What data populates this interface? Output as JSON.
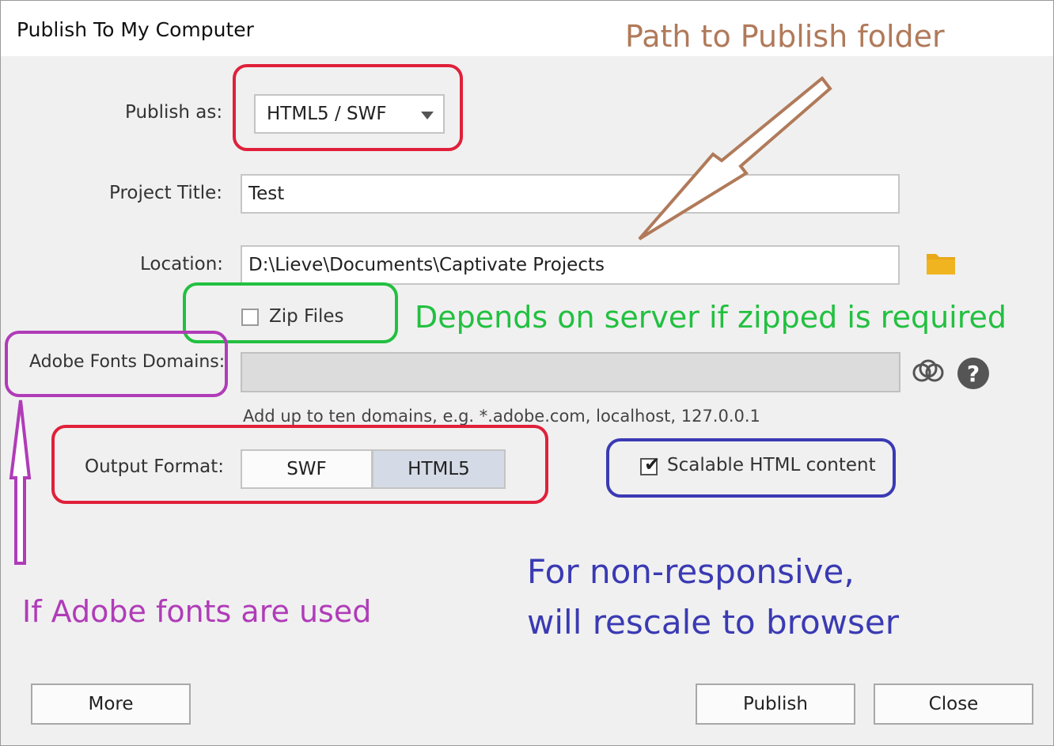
{
  "window": {
    "title": "Publish To My Computer"
  },
  "form": {
    "publish_as": {
      "label": "Publish as:",
      "value": "HTML5 / SWF"
    },
    "project_title": {
      "label": "Project Title:",
      "value": "Test"
    },
    "location": {
      "label": "Location:",
      "value": "D:\\Lieve\\Documents\\Captivate Projects"
    },
    "zip_files": {
      "label": "Zip Files",
      "checked": false
    },
    "adobe_fonts": {
      "label": "Adobe Fonts Domains:",
      "value": "",
      "hint": "Add up to ten domains, e.g. *.adobe.com, localhost, 127.0.0.1"
    },
    "output_format": {
      "label": "Output Format:",
      "options": [
        "SWF",
        "HTML5"
      ],
      "selected": "HTML5"
    },
    "scalable": {
      "label": "Scalable HTML content",
      "checked": true
    }
  },
  "buttons": {
    "more": "More",
    "publish": "Publish",
    "close": "Close"
  },
  "annotations": {
    "path": {
      "text": "Path to Publish folder",
      "color": "#b07a5a"
    },
    "zip": {
      "text": "Depends on server if zipped is required",
      "color": "#22c040"
    },
    "fonts": {
      "text": "If Adobe fonts are used",
      "color": "#b03cb8"
    },
    "scalable_line1": "For non-responsive,",
    "scalable_line2": "will rescale to browser",
    "scalable_color": "#3a3ab4"
  },
  "colors": {
    "red_ring": "#e0203a",
    "green_ring": "#22c040",
    "purple_ring": "#b03cb8",
    "blue_ring": "#3a3ab4",
    "folder": "#e8a818"
  },
  "icons": [
    "folder-icon",
    "creative-cloud-icon",
    "help-icon",
    "dropdown-caret-icon",
    "checkmark-icon"
  ]
}
